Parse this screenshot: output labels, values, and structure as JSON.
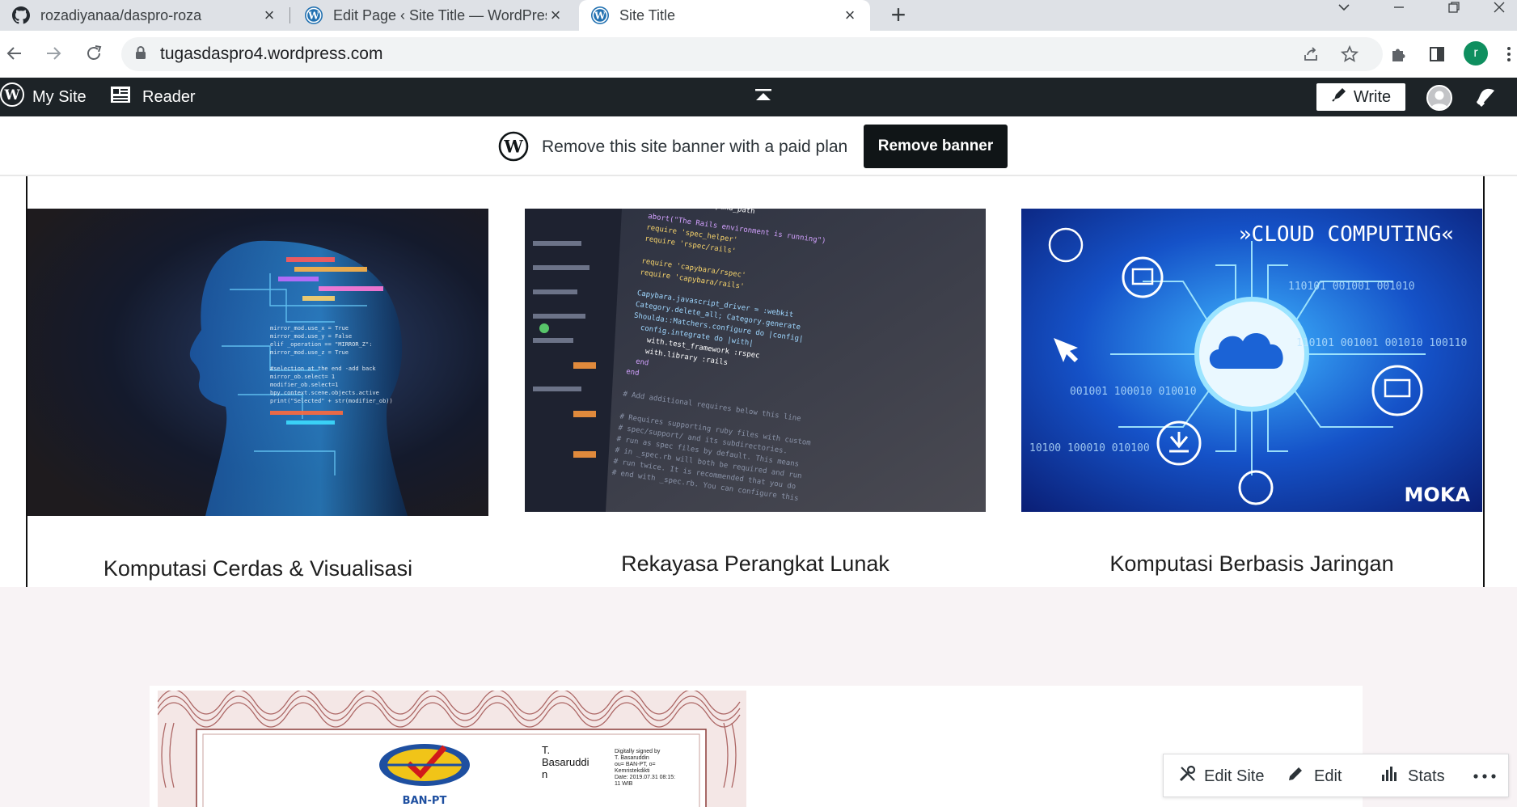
{
  "browser": {
    "tabs": [
      {
        "title": "rozadiyanaa/daspro-roza",
        "icon": "github-icon"
      },
      {
        "title": "Edit Page ‹ Site Title — WordPress",
        "icon": "wordpress-icon"
      },
      {
        "title": "Site Title",
        "icon": "wordpress-icon",
        "active": true
      }
    ],
    "url": "tugasdaspro4.wordpress.com",
    "profile_initial": "r"
  },
  "adminbar": {
    "my_site": "My Site",
    "reader": "Reader",
    "write": "Write"
  },
  "banner": {
    "text": "Remove this site banner with a paid plan",
    "button": "Remove banner"
  },
  "cards": [
    {
      "title": "Komputasi Cerdas & Visualisasi"
    },
    {
      "title": "Rekayasa Perangkat Lunak",
      "image_text": "require File.expand_path"
    },
    {
      "title": "Komputasi Berbasis Jaringan",
      "image_text": "»CLOUD COMPUTING«",
      "image_brand": "MOKA"
    }
  ],
  "certificate": {
    "signer": "T.\nBasaruddi\nn",
    "signer_lines": [
      "T.",
      "Basaruddi",
      "n"
    ],
    "signature_note": [
      "Digitally signed by",
      "T. Basaruddin",
      "ou= BAN-PT, o=",
      "Kemristekdikti",
      "Date: 2019.07.31 08:15:",
      "11 WIB"
    ],
    "logo_text": "BAN-PT"
  },
  "floating_bar": {
    "edit_site": "Edit Site",
    "edit": "Edit",
    "stats": "Stats"
  },
  "colors": {
    "adminbar_bg": "#1d2327",
    "banner_button_bg": "#101517",
    "tabstrip_bg": "#dee1e6",
    "profile_green": "#0f8f5f",
    "page_lower_bg": "#f8f3f5"
  }
}
